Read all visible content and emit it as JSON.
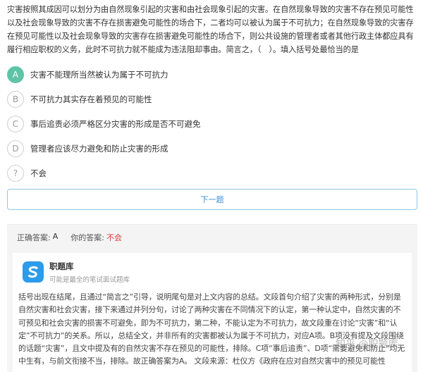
{
  "question": {
    "text": "灾害按照其成因可以划分为由自然现象引起的灾害和由社会现象引起的灾害。在自然现象导致的灾害不存在预见可能性以及社会现象导致的灾害不存在损害避免可能性的场合下，二者均可以被认为属于不可抗力；在自然现象导致的灾害存在预见可能性以及社会现象导致的灾害存在损害避免可能性的场合下，则公共设施的管理者或者其他行政主体都应具有履行相应职权的义务，此时不可抗力就不能成为违法阻却事由。简言之，（　）。填入括号处最恰当的是"
  },
  "options": [
    {
      "key": "A",
      "label": "灾害不能理所当然被认为属于不可抗力",
      "selected": true
    },
    {
      "key": "B",
      "label": "不可抗力其实存在着预见的可能性",
      "selected": false
    },
    {
      "key": "C",
      "label": "事后追责必须严格区分灾害的形成是否不可避免",
      "selected": false
    },
    {
      "key": "D",
      "label": "管理者应该尽力避免和防止灾害的形成",
      "selected": false
    },
    {
      "key": "?",
      "label": "不会",
      "selected": false
    }
  ],
  "next_button": {
    "label": "下一题"
  },
  "answer": {
    "correct_label": "正确答案:",
    "correct_value": "A",
    "yours_label": "你的答案:",
    "yours_value": "不会"
  },
  "explanation": {
    "brand_name": "职题库",
    "brand_sub": "可能是最全的笔试面试题库",
    "text": "括号出现在结尾，且通过“简言之”引导，说明尾句是对上文内容的总结。文段首句介绍了灾害的两种形式，分别是自然灾害和社会灾害，接下来通过并列分句，讨论了两种灾害在不同情况下的认定，第一种认定中，自然灾害的不可预见和社会灾害的损害不可避免，即为不可抗力，第二种，不能认定为不可抗力，故文段重在讨论“灾害”和“认定”不可抗力”的关系。所以，总结全文，并非所有的灾害都被认为属于不可抗力，对应A项。B项没有提及文段围绕的话题“灾害”，且文中提及有的自然灾害不存在预见的可能性，排除。C项“事后追责”、D项“需要避免和防止”均无中生有，与前文衔接不当，排除。故正确答案为A。 文段来源：杜仪方《政府在应对自然灾害中的预见可能性"
  },
  "watermark": "知乎 @职题库",
  "colors": {
    "selected_badge": "#5fc4a6",
    "button_text": "#3a8fd6",
    "wrong_answer": "#e23a3a",
    "logo_bg": "#2b9bea"
  }
}
